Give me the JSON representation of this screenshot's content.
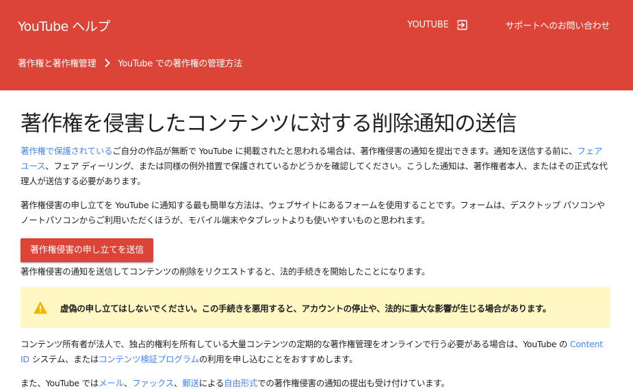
{
  "header": {
    "brand": "YouTube ヘルプ",
    "youtube_link": "YOUTUBE",
    "support_link": "サポートへのお問い合わせ",
    "breadcrumb": [
      "著作権と著作権管理",
      "YouTube での著作権の管理方法"
    ]
  },
  "main": {
    "title": "著作権を侵害したコンテンツに対する削除通知の送信",
    "para1": {
      "link1": "著作権で保護されている",
      "text1": "ご自分の作品が無断で YouTube に掲載されたと思われる場合は、著作権侵害の通知を提出できます。通知を送信する前に、",
      "link2": "フェアユース",
      "text2": "、フェア ディーリング、または同様の例外措置で保護されているかどうかを確認してください。こうした通知は、著作権者本人、またはその正式な代理人が送信する必要があります。"
    },
    "para2": "著作権侵害の申し立てを YouTube に通知する最も簡単な方法は、ウェブサイトにあるフォームを使用することです。フォームは、デスクトップ パソコンやノートパソコンからご利用いただくほうが、モバイル端末やタブレットよりも使いやすいものと思われます。",
    "submit_button": "著作権侵害の申し立てを送信",
    "para3": "著作権侵害の通知を送信してコンテンツの削除をリクエストすると、法的手続きを開始したことになります。",
    "warning": "虚偽の申し立てはしないでください。この手続きを悪用すると、アカウントの停止や、法的に重大な影響が生じる場合があります。",
    "para4": {
      "text1": "コンテンツ所有者が法人で、独占的権利を所有している大量コンテンツの定期的な著作権管理をオンラインで行う必要がある場合は、YouTube の ",
      "link1": "Content ID",
      "text2": " システム、または",
      "link2": "コンテンツ検証プログラム",
      "text3": "の利用を申し込むことをおすすめします。"
    },
    "para5": {
      "text1": "また、YouTube では",
      "link1": "メール",
      "sep1": "、",
      "link2": "ファックス",
      "sep2": "、",
      "link3": "郵送",
      "text2": "による",
      "link4": "自由形式",
      "text3": "での著作権侵害の通知の提出も受け付けています。"
    }
  },
  "colors": {
    "header_bg": "#db4437",
    "link": "#4285f4",
    "warning_bg": "#fff8c4",
    "warning_icon": "#f4b400"
  }
}
